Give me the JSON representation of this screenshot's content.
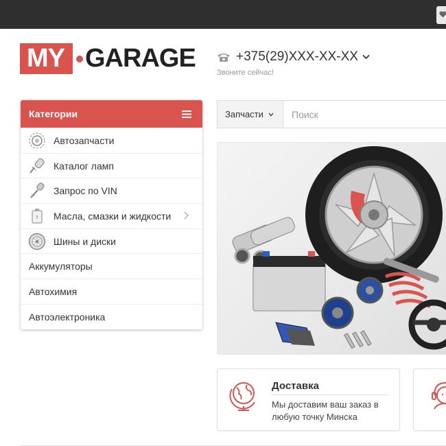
{
  "logo": {
    "part1": "MY",
    "part2": "GARAGE"
  },
  "header": {
    "phone": "+375(29)XXX-XX-XX",
    "phone_sub": "Звоните сейчас!"
  },
  "categories": {
    "title": "Категории",
    "items": [
      {
        "label": "Автозапчасти",
        "icon": "gear-icon"
      },
      {
        "label": "Каталог ламп",
        "icon": "lamp-icon"
      },
      {
        "label": "Запрос по VIN",
        "icon": "key-icon"
      },
      {
        "label": "Масла, смазки и жидкости",
        "icon": "oil-can-icon",
        "has_submenu": true
      },
      {
        "label": "Шины и диски",
        "icon": "tire-icon"
      },
      {
        "label": "Аккумуляторы"
      },
      {
        "label": "Автохимия"
      },
      {
        "label": "Автоэлектроника"
      }
    ]
  },
  "search": {
    "category": "Запчасти",
    "placeholder": "Поиск"
  },
  "features": [
    {
      "title": "Доставка",
      "text": "Мы доставим ваш заказ в любую точку Минска",
      "icon": "globe-icon"
    },
    {
      "icon": "support-agent-icon"
    }
  ],
  "colors": {
    "accent": "#d9534f",
    "dark": "#2f2f2f"
  }
}
